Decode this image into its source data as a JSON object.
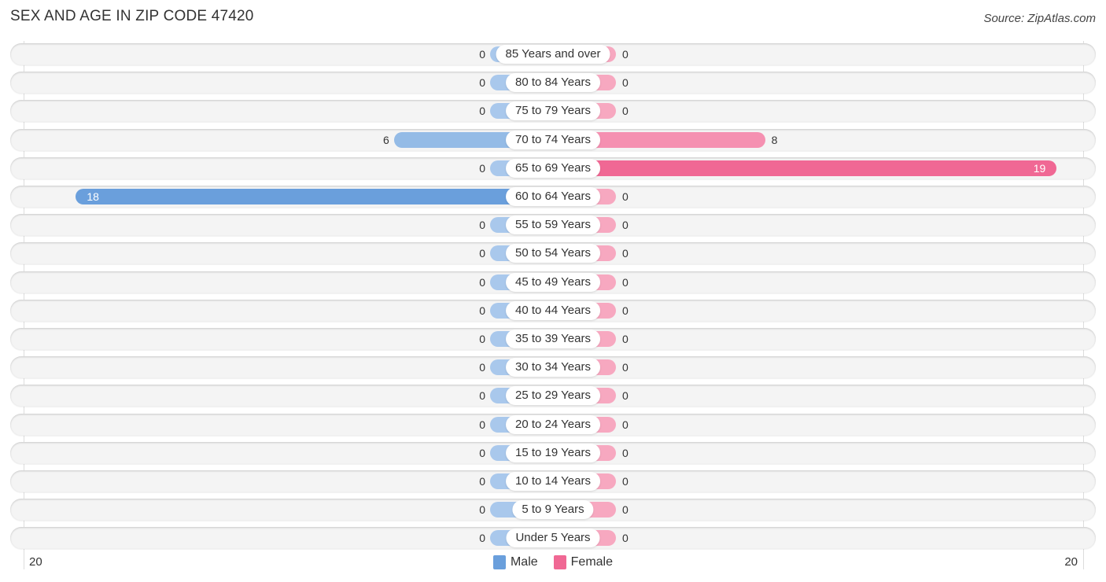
{
  "title": "SEX AND AGE IN ZIP CODE 47420",
  "source": "Source: ZipAtlas.com",
  "colors": {
    "male_strong": "#6a9fdc",
    "male_light": "#a9c8ec",
    "female_strong": "#f06894",
    "female_light": "#f7a8c0"
  },
  "chart_data": {
    "type": "bar",
    "orientation": "horizontal-butterfly",
    "title": "SEX AND AGE IN ZIP CODE 47420",
    "categories": [
      "85 Years and over",
      "80 to 84 Years",
      "75 to 79 Years",
      "70 to 74 Years",
      "65 to 69 Years",
      "60 to 64 Years",
      "55 to 59 Years",
      "50 to 54 Years",
      "45 to 49 Years",
      "40 to 44 Years",
      "35 to 39 Years",
      "30 to 34 Years",
      "25 to 29 Years",
      "20 to 24 Years",
      "15 to 19 Years",
      "10 to 14 Years",
      "5 to 9 Years",
      "Under 5 Years"
    ],
    "series": [
      {
        "name": "Male",
        "values": [
          0,
          0,
          0,
          6,
          0,
          18,
          0,
          0,
          0,
          0,
          0,
          0,
          0,
          0,
          0,
          0,
          0,
          0
        ]
      },
      {
        "name": "Female",
        "values": [
          0,
          0,
          0,
          8,
          19,
          0,
          0,
          0,
          0,
          0,
          0,
          0,
          0,
          0,
          0,
          0,
          0,
          0
        ]
      }
    ],
    "axis": {
      "min_label": "20",
      "max_label": "20",
      "range": [
        -20,
        20
      ]
    },
    "legend": {
      "position": "bottom-center",
      "entries": [
        "Male",
        "Female"
      ]
    }
  }
}
